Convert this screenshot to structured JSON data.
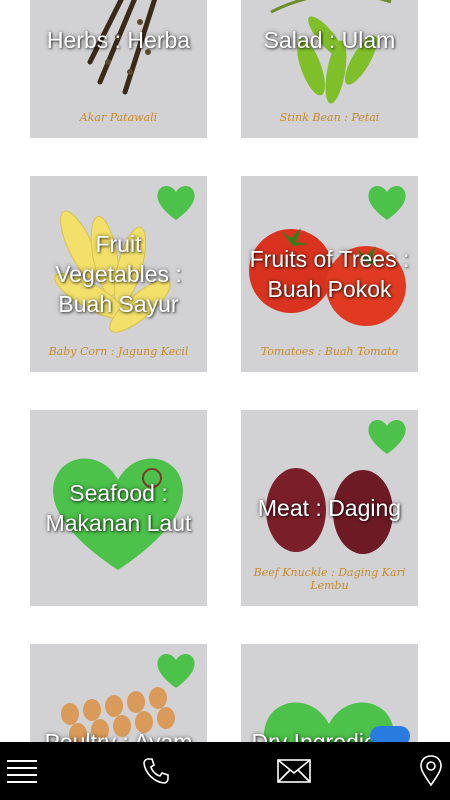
{
  "tiles": [
    {
      "title": "Herbs : Herba",
      "caption": "Akar Patawali"
    },
    {
      "title": "Salad : Ulam",
      "caption": "Stink Bean : Petai"
    },
    {
      "title": "Fruit Vegetables : Buah Sayur",
      "caption": "Baby Corn : Jagung Kecil"
    },
    {
      "title": "Fruits of Trees : Buah Pokok",
      "caption": "Tomatoes : Buah Tomato"
    },
    {
      "title": "Seafood : Makanan Laut",
      "caption": ""
    },
    {
      "title": "Meat : Daging",
      "caption": "Beef Knuckle : Daging Kari Lembu"
    },
    {
      "title": "Poultry : Ayam",
      "caption": ""
    },
    {
      "title": "Dry Ingredients",
      "caption": ""
    }
  ],
  "bottom_nav": {
    "menu": "menu-icon",
    "phone": "phone-icon",
    "mail": "mail-icon",
    "location": "location-pin-icon"
  },
  "colors": {
    "tile_bg": "#d2d2d4",
    "bar_bg": "#000000",
    "heart_green": "#4cc24a",
    "caption_gold": "#c98a2c"
  }
}
